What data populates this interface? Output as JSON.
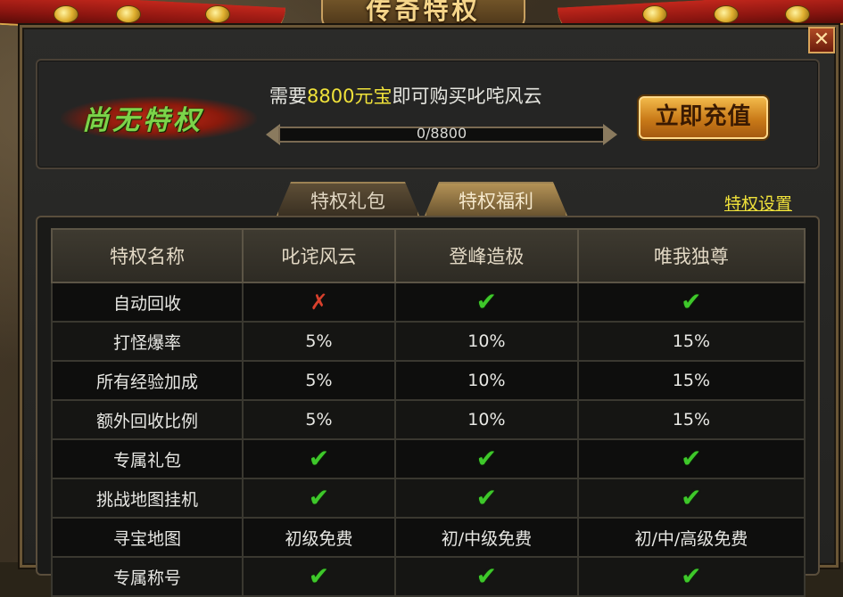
{
  "window": {
    "title": "传奇特权",
    "close_label": "✕"
  },
  "status": {
    "current_privilege": "尚无特权",
    "need_prefix": "需要",
    "need_amount": "8800元宝",
    "need_suffix": "即可购买叱咤风云",
    "progress_text": "0/8800",
    "progress_fraction": 0,
    "recharge_label": "立即充值"
  },
  "tabs": [
    {
      "label": "特权礼包",
      "active": false
    },
    {
      "label": "特权福利",
      "active": true
    }
  ],
  "settings_link": "特权设置",
  "table": {
    "headers": [
      "特权名称",
      "叱诧风云",
      "登峰造极",
      "唯我独尊"
    ],
    "rows": [
      {
        "name": "自动回收",
        "cells": [
          "✗",
          "✔",
          "✔"
        ]
      },
      {
        "name": "打怪爆率",
        "cells": [
          "5%",
          "10%",
          "15%"
        ]
      },
      {
        "name": "所有经验加成",
        "cells": [
          "5%",
          "10%",
          "15%"
        ]
      },
      {
        "name": "额外回收比例",
        "cells": [
          "5%",
          "10%",
          "15%"
        ]
      },
      {
        "name": "专属礼包",
        "cells": [
          "✔",
          "✔",
          "✔"
        ]
      },
      {
        "name": "挑战地图挂机",
        "cells": [
          "✔",
          "✔",
          "✔"
        ]
      },
      {
        "name": "寻宝地图",
        "cells": [
          "初级免费",
          "初/中级免费",
          "初/中/高级免费"
        ]
      },
      {
        "name": "专属称号",
        "cells": [
          "✔",
          "✔",
          "✔"
        ]
      }
    ]
  },
  "colors": {
    "accent_yellow": "#f0e23a",
    "check_green": "#3ec82a",
    "cross_red": "#d8402c"
  }
}
